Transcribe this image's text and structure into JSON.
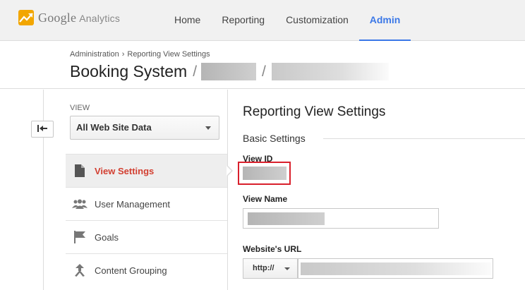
{
  "app": {
    "brand": "Google",
    "product": "Analytics"
  },
  "nav": {
    "home": "Home",
    "reporting": "Reporting",
    "customization": "Customization",
    "admin": "Admin"
  },
  "header": {
    "breadcrumb_1": "Administration",
    "breadcrumb_sep": "›",
    "breadcrumb_2": "Reporting View Settings",
    "title": "Booking System",
    "slash": "/"
  },
  "sidebar": {
    "view_label": "VIEW",
    "view_selected": "All Web Site Data",
    "items": [
      {
        "label": "View Settings",
        "icon": "document-icon",
        "active": true
      },
      {
        "label": "User Management",
        "icon": "users-icon",
        "active": false
      },
      {
        "label": "Goals",
        "icon": "flag-icon",
        "active": false
      },
      {
        "label": "Content Grouping",
        "icon": "content-grouping-icon",
        "active": false
      }
    ]
  },
  "main": {
    "title": "Reporting View Settings",
    "section": "Basic Settings",
    "view_id_label": "View ID",
    "view_name_label": "View Name",
    "website_url_label": "Website's URL",
    "protocol": "http://"
  },
  "colors": {
    "accent": "#3b78e7",
    "active_item": "#d23f31",
    "highlight_box": "#d9202c",
    "logo": "#f2a600"
  }
}
